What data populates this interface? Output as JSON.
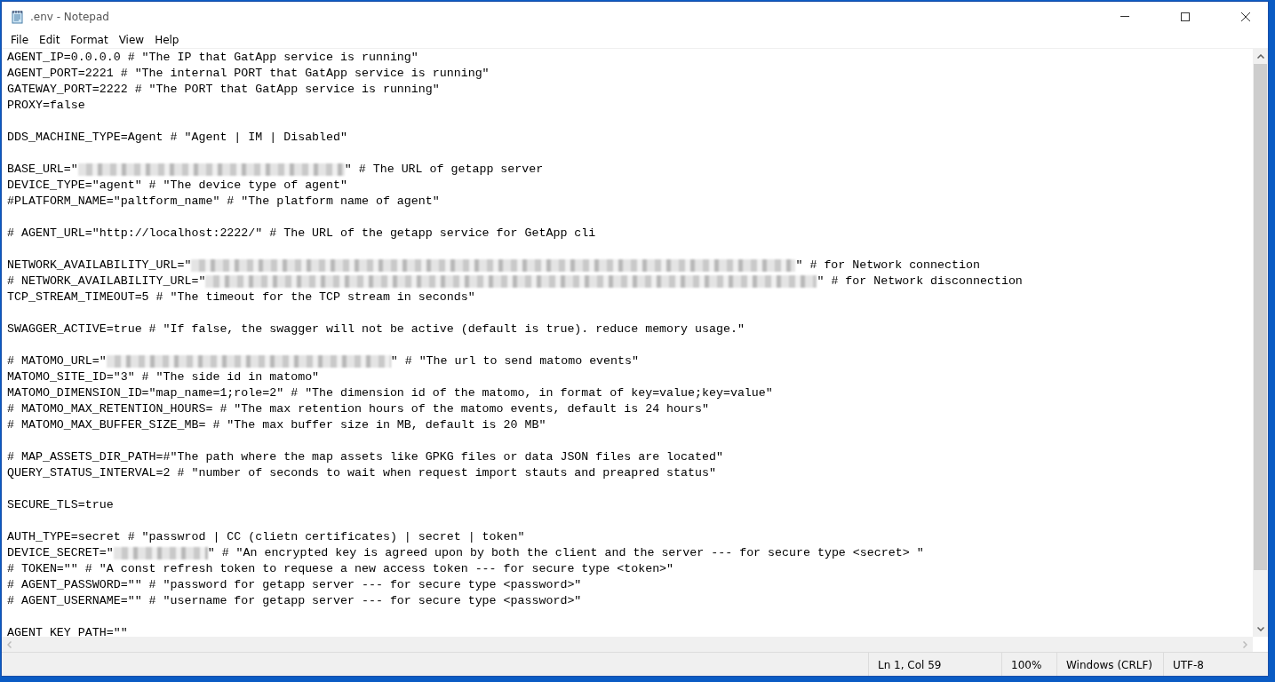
{
  "window": {
    "title": ".env - Notepad"
  },
  "menu": [
    "File",
    "Edit",
    "Format",
    "View",
    "Help"
  ],
  "lines": [
    {
      "parts": [
        {
          "text": "AGENT_IP=0.0.0.0 # \"The IP that GatApp service is running\""
        }
      ]
    },
    {
      "parts": [
        {
          "text": "AGENT_PORT=2221 # \"The internal PORT that GatApp service is running\""
        }
      ]
    },
    {
      "parts": [
        {
          "text": "GATEWAY_PORT=2222 # \"The PORT that GatApp service is running\""
        }
      ]
    },
    {
      "parts": [
        {
          "text": "PROXY=false"
        }
      ]
    },
    {
      "kind": "blank"
    },
    {
      "parts": [
        {
          "text": "DDS_MACHINE_TYPE=Agent # \"Agent | IM | Disabled\""
        }
      ]
    },
    {
      "kind": "blank"
    },
    {
      "parts": [
        {
          "text": "BASE_URL=\""
        },
        {
          "kind": "redacted"
        },
        {
          "text": "\" # The URL of getapp server"
        }
      ]
    },
    {
      "parts": [
        {
          "text": "DEVICE_TYPE=\"agent\" # \"The device type of agent\""
        }
      ]
    },
    {
      "parts": [
        {
          "text": "#PLATFORM_NAME=\"paltform_name\" # \"The platform name of agent\""
        }
      ]
    },
    {
      "kind": "blank"
    },
    {
      "parts": [
        {
          "text": "# AGENT_URL=\"http://localhost:2222/\" # The URL of the getapp service for GetApp cli"
        }
      ]
    },
    {
      "kind": "blank"
    },
    {
      "parts": [
        {
          "text": "NETWORK_AVAILABILITY_URL=\""
        },
        {
          "kind": "redacted"
        },
        {
          "text": "\" # for Network connection"
        }
      ]
    },
    {
      "parts": [
        {
          "text": "# NETWORK_AVAILABILITY_URL=\""
        },
        {
          "kind": "redacted"
        },
        {
          "text": "\" # for Network disconnection"
        }
      ]
    },
    {
      "parts": [
        {
          "text": "TCP_STREAM_TIMEOUT=5 # \"The timeout for the TCP stream in seconds\""
        }
      ]
    },
    {
      "kind": "blank"
    },
    {
      "parts": [
        {
          "text": "SWAGGER_ACTIVE=true # \"If false, the swagger will not be active (default is true). reduce memory usage.\""
        }
      ]
    },
    {
      "kind": "blank"
    },
    {
      "parts": [
        {
          "text": "# MATOMO_URL=\""
        },
        {
          "kind": "redacted"
        },
        {
          "text": "\" # \"The url to send matomo events\""
        }
      ]
    },
    {
      "parts": [
        {
          "text": "MATOMO_SITE_ID=\"3\" # \"The side id in matomo\""
        }
      ]
    },
    {
      "parts": [
        {
          "text": "MATOMO_DIMENSION_ID=\"map_name=1;role=2\" # \"The dimension id of the matomo, in format of key=value;key=value\""
        }
      ]
    },
    {
      "parts": [
        {
          "text": "# MATOMO_MAX_RETENTION_HOURS= # \"The max retention hours of the matomo events, default is 24 hours\""
        }
      ]
    },
    {
      "parts": [
        {
          "text": "# MATOMO_MAX_BUFFER_SIZE_MB= # \"The max buffer size in MB, default is 20 MB\""
        }
      ]
    },
    {
      "kind": "blank"
    },
    {
      "parts": [
        {
          "text": "# MAP_ASSETS_DIR_PATH=#\"The path where the map assets like GPKG files or data JSON files are located\""
        }
      ]
    },
    {
      "parts": [
        {
          "text": "QUERY_STATUS_INTERVAL=2 # \"number of seconds to wait when request import stauts and preapred status\""
        }
      ]
    },
    {
      "kind": "blank"
    },
    {
      "parts": [
        {
          "text": "SECURE_TLS=true"
        }
      ]
    },
    {
      "kind": "blank"
    },
    {
      "parts": [
        {
          "text": "AUTH_TYPE=secret # \"passwrod | CC (clietn certificates) | secret | token\""
        }
      ]
    },
    {
      "parts": [
        {
          "text": "DEVICE_SECRET=\""
        },
        {
          "kind": "redacted"
        },
        {
          "text": "\" # \"An encrypted key is agreed upon by both the client and the server --- for secure type <secret> \""
        }
      ]
    },
    {
      "parts": [
        {
          "text": "# TOKEN=\"\" # \"A const refresh token to requese a new access token --- for secure type <token>\""
        }
      ]
    },
    {
      "parts": [
        {
          "text": "# AGENT_PASSWORD=\"\" # \"password for getapp server --- for secure type <password>\""
        }
      ]
    },
    {
      "parts": [
        {
          "text": "# AGENT_USERNAME=\"\" # \"username for getapp server --- for secure type <password>\""
        }
      ]
    },
    {
      "kind": "blank"
    },
    {
      "parts": [
        {
          "text": "AGENT_KEY_PATH=\"\""
        }
      ]
    }
  ],
  "status_bar": [
    "Ln 1, Col 59",
    "100%",
    "Windows (CRLF)",
    "UTF-8"
  ]
}
